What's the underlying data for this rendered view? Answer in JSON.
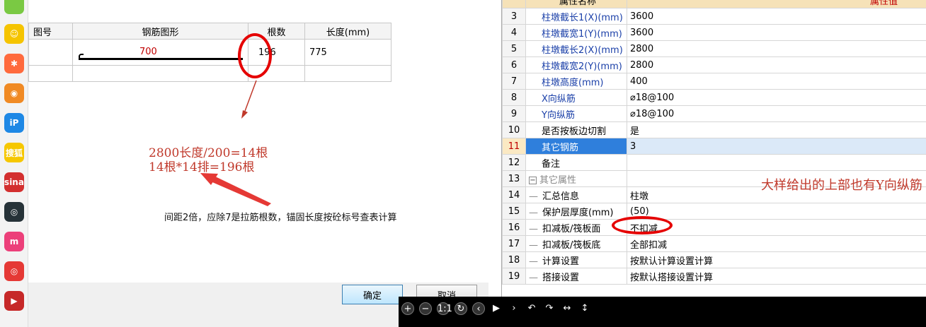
{
  "taskbar": {
    "icons": [
      {
        "name": "green-ring-app-icon",
        "glyph": "",
        "color": "#7ac943"
      },
      {
        "name": "yellow-face-app-icon",
        "glyph": "☺",
        "color": "#f5c400"
      },
      {
        "name": "pinwheel-app-icon",
        "glyph": "✱",
        "color": "#ff6a3d"
      },
      {
        "name": "orange-bot-app-icon",
        "glyph": "◉",
        "color": "#f08a24"
      },
      {
        "name": "ip-app-icon",
        "glyph": "iP",
        "color": "#1e88e5"
      },
      {
        "name": "sogou-app-icon",
        "glyph": "搜狐",
        "color": "#f6c700"
      },
      {
        "name": "sina-app-icon",
        "glyph": "sina",
        "color": "#d32f2f"
      },
      {
        "name": "owl-app-icon",
        "glyph": "◎",
        "color": "#263238"
      },
      {
        "name": "m-app-icon",
        "glyph": "m",
        "color": "#ec407a"
      },
      {
        "name": "spiral-app-icon",
        "glyph": "◎",
        "color": "#e53935"
      },
      {
        "name": "play-app-icon",
        "glyph": "▶",
        "color": "#c62828"
      }
    ]
  },
  "rebar_table": {
    "headers": [
      "图号",
      "钢筋图形",
      "根数",
      "长度(mm)"
    ],
    "row": {
      "shape_length": "700",
      "count": "196",
      "length": "775"
    }
  },
  "annotations": {
    "red_line1": "2800长度/200=14根",
    "red_line2": "14根*14排=196根",
    "black_note": "间距2倍，应除7是拉筋根数，锚固长度按砼标号查表计算",
    "right_note": "大样给出的上部也有Y向纵筋"
  },
  "dialog": {
    "ok_label": "确定",
    "cancel_label": "取消"
  },
  "properties": {
    "header_name": "属性名称",
    "header_value": "属性值",
    "rows": [
      {
        "num": "3",
        "name": "柱墩截长1(X)(mm)",
        "value": "3600",
        "blue": true
      },
      {
        "num": "4",
        "name": "柱墩截宽1(Y)(mm)",
        "value": "3600",
        "blue": true
      },
      {
        "num": "5",
        "name": "柱墩截长2(X)(mm)",
        "value": "2800",
        "blue": true
      },
      {
        "num": "6",
        "name": "柱墩截宽2(Y)(mm)",
        "value": "2800",
        "blue": true
      },
      {
        "num": "7",
        "name": "柱墩高度(mm)",
        "value": "400",
        "blue": true
      },
      {
        "num": "8",
        "name": "X向纵筋",
        "value": "⌀18@100",
        "blue": true
      },
      {
        "num": "9",
        "name": "Y向纵筋",
        "value": "⌀18@100",
        "blue": true
      },
      {
        "num": "10",
        "name": "是否按板边切割",
        "value": "是",
        "blue": false
      },
      {
        "num": "11",
        "name": "其它钢筋",
        "value": "3",
        "blue": false,
        "selected": true
      },
      {
        "num": "12",
        "name": "备注",
        "value": "",
        "blue": false
      },
      {
        "num": "13",
        "name": "其它属性",
        "value": "",
        "blue": false,
        "group": true
      },
      {
        "num": "14",
        "name": "汇总信息",
        "value": "柱墩",
        "blue": false,
        "child": true
      },
      {
        "num": "15",
        "name": "保护层厚度(mm)",
        "value": "(50)",
        "blue": false,
        "child": true
      },
      {
        "num": "16",
        "name": "扣减板/筏板面",
        "value": "不扣减",
        "blue": false,
        "child": true
      },
      {
        "num": "17",
        "name": "扣减板/筏板底",
        "value": "全部扣减",
        "blue": false,
        "child": true
      },
      {
        "num": "18",
        "name": "计算设置",
        "value": "按默认计算设置计算",
        "blue": false,
        "child": true
      },
      {
        "num": "19",
        "name": "搭接设置",
        "value": "按默认搭接设置计算",
        "blue": false,
        "child": true
      }
    ]
  },
  "toolbar": {
    "tools": [
      "+",
      "−",
      "1:1",
      "↻",
      "‹",
      "▶",
      "›",
      "↶",
      "↷",
      "↔",
      "↕"
    ]
  }
}
